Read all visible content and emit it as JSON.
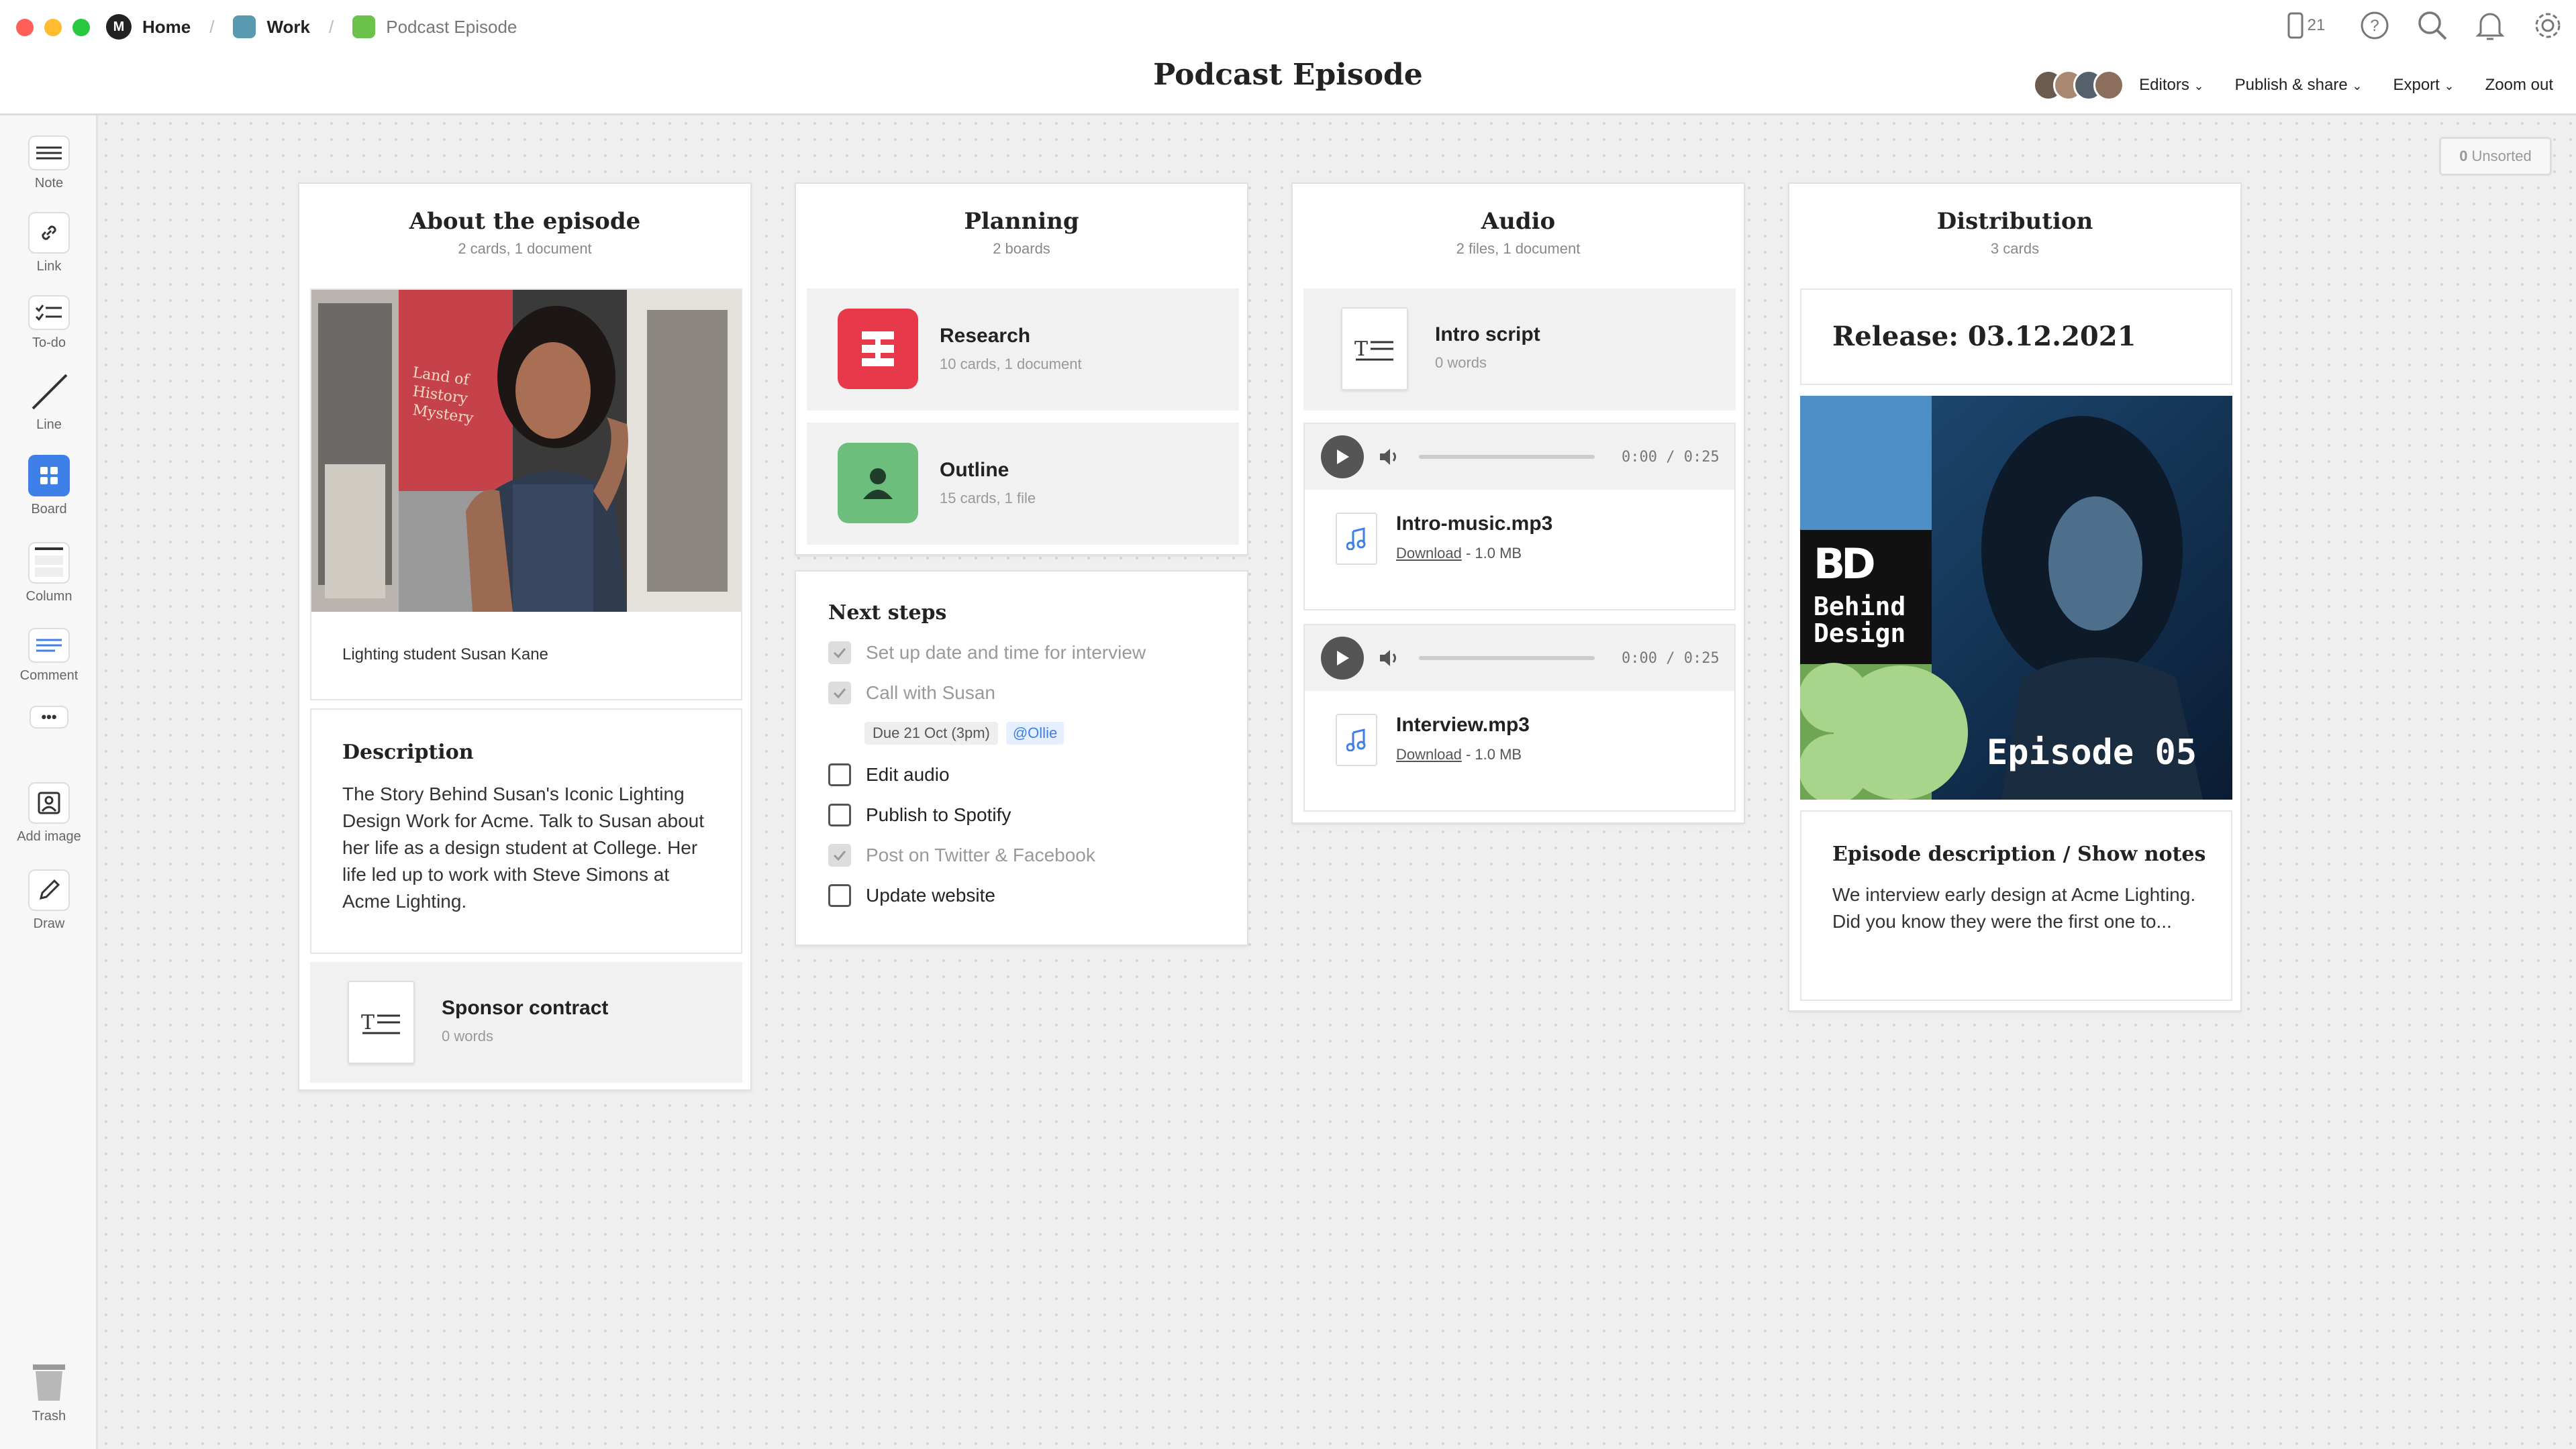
{
  "window": {
    "traffic_colors": [
      "#fe5f57",
      "#febc2e",
      "#28c840"
    ]
  },
  "breadcrumbs": [
    {
      "label": "Home",
      "color": "#222222"
    },
    {
      "label": "Work",
      "color": "#5a9ab0"
    },
    {
      "label": "Podcast Episode",
      "color": "#6cc24a"
    }
  ],
  "top": {
    "device_count": "21"
  },
  "title": "Podcast Episode",
  "toolbar": {
    "editors": "Editors",
    "publish": "Publish & share",
    "export": "Export",
    "zoom": "Zoom out"
  },
  "sidebar": {
    "note": "Note",
    "link": "Link",
    "todo": "To-do",
    "line": "Line",
    "board": "Board",
    "column": "Column",
    "comment": "Comment",
    "more": "•••",
    "add_image": "Add image",
    "draw": "Draw",
    "trash": "Trash"
  },
  "unsorted": {
    "count": "0",
    "label": "Unsorted"
  },
  "about": {
    "title": "About the episode",
    "sub": "2 cards, 1 document",
    "caption": "Lighting student Susan Kane",
    "desc_title": "Description",
    "desc_text": "The Story Behind Susan's Iconic Lighting Design Work for Acme. Talk to Susan about her life as a design student at College. Her life led up to work with Steve Simons at Acme Lighting.",
    "doc_title": "Sponsor contract",
    "doc_sub": "0 words"
  },
  "planning": {
    "title": "Planning",
    "sub": "2 boards",
    "boards": [
      {
        "title": "Research",
        "sub": "10 cards, 1 document",
        "color": "#e8394b"
      },
      {
        "title": "Outline",
        "sub": "15 cards, 1 file",
        "color": "#6dbd7d"
      }
    ]
  },
  "next": {
    "title": "Next steps",
    "items": [
      {
        "label": "Set up date and time for interview",
        "done": true
      },
      {
        "label": "Call with Susan",
        "done": true
      },
      {
        "label": "Edit audio",
        "done": false
      },
      {
        "label": "Publish to Spotify",
        "done": false
      },
      {
        "label": "Post on Twitter & Facebook",
        "done": true
      },
      {
        "label": "Update website",
        "done": false
      }
    ],
    "due": "Due 21 Oct (3pm)",
    "mention": "@Ollie"
  },
  "audio": {
    "title": "Audio",
    "sub": "2 files, 1 document",
    "doc_title": "Intro script",
    "doc_sub": "0 words",
    "files": [
      {
        "time": "0:00 / 0:25",
        "name": "Intro-music.mp3",
        "download": "Download",
        "size": " - 1.0 MB"
      },
      {
        "time": "0:00 / 0:25",
        "name": "Interview.mp3",
        "download": "Download",
        "size": " - 1.0 MB"
      }
    ]
  },
  "distribution": {
    "title": "Distribution",
    "sub": "3 cards",
    "release": "Release: 03.12.2021",
    "cover_logo": "BD",
    "cover_brand": "Behind\nDesign",
    "cover_episode": "Episode 05",
    "notes_title": "Episode description / Show notes",
    "notes_text": "We interview early design at Acme Lighting. Did you know they were the first one to..."
  }
}
